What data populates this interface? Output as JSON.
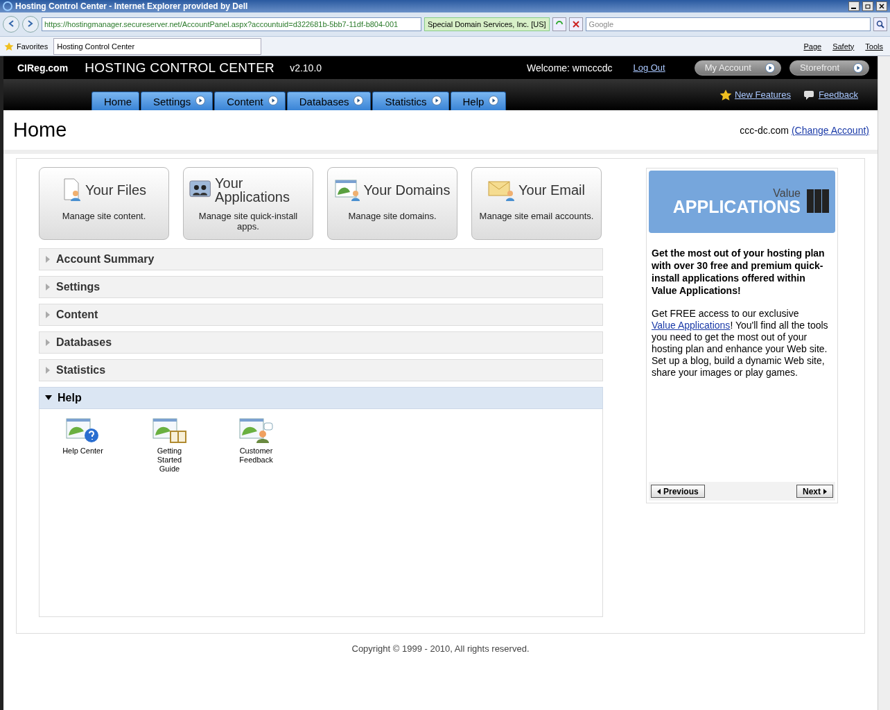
{
  "browser": {
    "title": "Hosting Control Center - Internet Explorer provided by Dell",
    "address": "https://hostingmanager.secureserver.net/AccountPanel.aspx?accountuid=d322681b-5bb7-11df-b804-001",
    "security": "Special Domain Services, Inc. [US]",
    "search_placeholder": "Google",
    "favorites": "Favorites",
    "tab": "Hosting Control Center",
    "commands": [
      "Page",
      "Safety",
      "Tools"
    ]
  },
  "header": {
    "brand": "CIReg.com",
    "title": "HOSTING CONTROL CENTER",
    "version": "v2.10.0",
    "welcome": "Welcome: wmcccdc",
    "logout": "Log Out",
    "buttons": [
      "My Account",
      "Storefront"
    ]
  },
  "nav": [
    {
      "label": "Home",
      "menu": false
    },
    {
      "label": "Settings",
      "menu": true
    },
    {
      "label": "Content",
      "menu": true
    },
    {
      "label": "Databases",
      "menu": true
    },
    {
      "label": "Statistics",
      "menu": true
    },
    {
      "label": "Help",
      "menu": true
    }
  ],
  "nav_links": {
    "new_features": "New Features",
    "feedback": "Feedback"
  },
  "page": {
    "title": "Home",
    "account": "ccc-dc.com",
    "change": "(Change Account)"
  },
  "cards": [
    {
      "kind": "files",
      "title": "Your Files",
      "desc": "Manage site content."
    },
    {
      "kind": "apps",
      "title": "Your Applications",
      "desc": "Manage site quick-install apps."
    },
    {
      "kind": "domains",
      "title": "Your Domains",
      "desc": "Manage site domains."
    },
    {
      "kind": "email",
      "title": "Your Email",
      "desc": "Manage site email accounts."
    }
  ],
  "sections": [
    {
      "label": "Account Summary",
      "expanded": false
    },
    {
      "label": "Settings",
      "expanded": false
    },
    {
      "label": "Content",
      "expanded": false
    },
    {
      "label": "Databases",
      "expanded": false
    },
    {
      "label": "Statistics",
      "expanded": false
    },
    {
      "label": "Help",
      "expanded": true
    }
  ],
  "help_items": [
    {
      "kind": "help",
      "label": "Help Center"
    },
    {
      "kind": "guide",
      "label": "Getting Started Guide"
    },
    {
      "kind": "feedback",
      "label": "Customer Feedback"
    }
  ],
  "promo": {
    "banner_small": "Value",
    "banner_big": "APPLICATIONS",
    "headline": "Get the most out of your hosting plan with over 30 free and premium quick-install applications offered within Value Applications!",
    "before": "Get FREE access to our exclusive ",
    "link": "Value Applications",
    "after": "! You'll find all the tools you need to get the most out of your hosting plan and enhance your Web site. Set up a blog, build a dynamic Web site, share your images or play games.",
    "previous": "Previous",
    "next": "Next"
  },
  "footer": "Copyright © 1999 - 2010, All rights reserved."
}
